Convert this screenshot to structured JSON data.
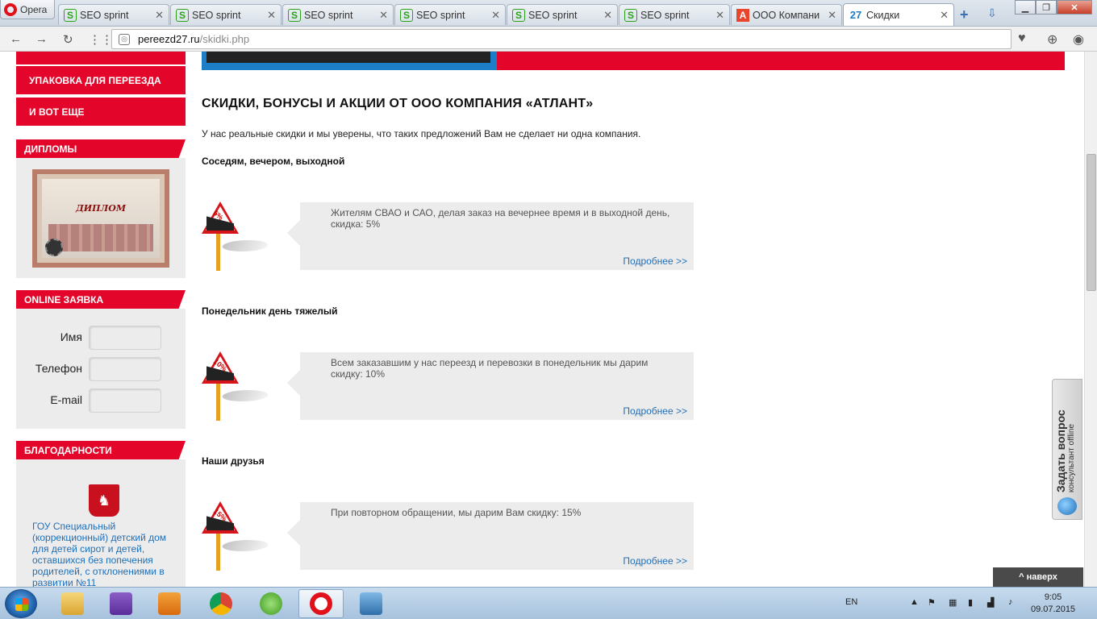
{
  "browser": {
    "menu_label": "Opera",
    "tabs": [
      {
        "label": "SEO sprint",
        "favicon": "seo-sprint-icon"
      },
      {
        "label": "SEO sprint",
        "favicon": "seo-sprint-icon"
      },
      {
        "label": "SEO sprint",
        "favicon": "seo-sprint-icon"
      },
      {
        "label": "SEO sprint",
        "favicon": "seo-sprint-icon"
      },
      {
        "label": "SEO sprint",
        "favicon": "seo-sprint-icon"
      },
      {
        "label": "SEO sprint",
        "favicon": "seo-sprint-icon"
      },
      {
        "label": "ООО Компани",
        "favicon": "a-letter-icon"
      },
      {
        "label": "Скидки",
        "favicon": "27-icon",
        "favicon_text": "27",
        "active": true
      }
    ],
    "url_domain": "pereezd27.ru",
    "url_path": "/skidki.php"
  },
  "sidebar": {
    "menu": [
      "УПАКОВКА ДЛЯ ПЕРЕЕЗДА",
      "И ВОТ ЕЩЕ"
    ],
    "diplomas_title": "ДИПЛОМЫ",
    "diploma_word": "ДИПЛОМ",
    "online_title": "ONLINE ЗАЯВКА",
    "form": {
      "name_label": "Имя",
      "phone_label": "Телефон",
      "email_label": "E-mail"
    },
    "thanks_title": "БЛАГОДАРНОСТИ",
    "thanks_link": "ГОУ Специальный (коррекционный) детский дом для детей сирот и детей, оставшихся без попечения родителей, с отклонениями в развитии №11"
  },
  "content": {
    "title": "СКИДКИ, БОНУСЫ И АКЦИИ ОТ ООО КОМПАНИЯ «АТЛАНТ»",
    "intro": "У нас реальные скидки и мы уверены, что таких предложений Вам не сделает ни одна компания.",
    "offers": [
      {
        "title": "Соседям, вечером, выходной",
        "percent": "5%",
        "text": "Жителям СВАО и САО, делая заказ на вечернее время и в выходной день, скидка: 5%",
        "more": "Подробнее >>"
      },
      {
        "title": "Понедельник день тяжелый",
        "percent": "10%",
        "text": "Всем заказавшим у нас переезд и перевозки в понедельник мы дарим скидку: 10%",
        "more": "Подробнее >>"
      },
      {
        "title": "Наши друзья",
        "percent": "15%",
        "text": "При повторном обращении, мы дарим Вам скидку: 15%",
        "more": "Подробнее >>"
      }
    ]
  },
  "widget": {
    "ask_label": "Задать вопрос",
    "status_label": "консультант offline",
    "to_top_label": "^ наверх"
  },
  "taskbar": {
    "language": "EN",
    "time": "9:05",
    "date": "09.07.2015"
  },
  "colors": {
    "accent_red": "#e3062a",
    "link_blue": "#1f6fb8",
    "panel_gray": "#ececec"
  }
}
